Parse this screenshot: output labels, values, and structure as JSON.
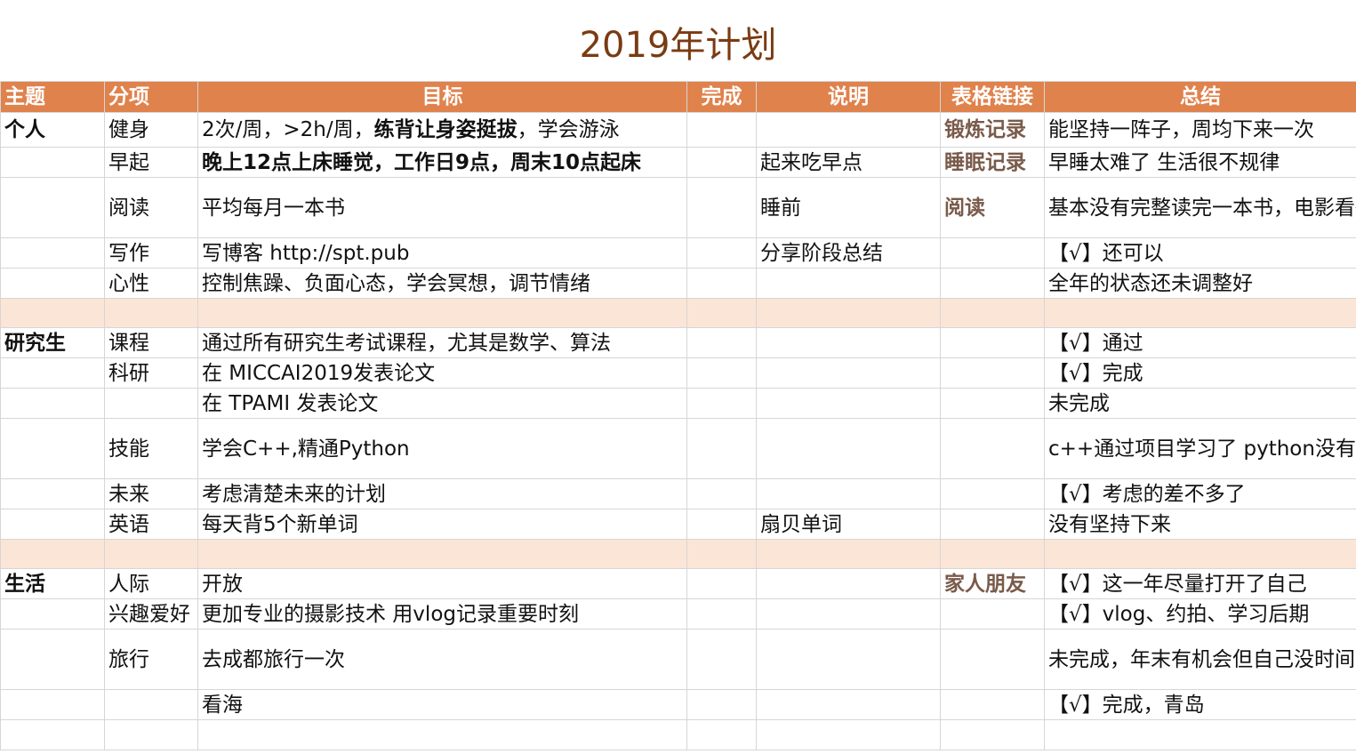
{
  "title": "2019年计划",
  "headers": [
    "主题",
    "分项",
    "目标",
    "完成",
    "说明",
    "表格链接",
    "总结"
  ],
  "rows": {
    "r1": {
      "theme": "个人",
      "sub": "健身",
      "goal_a": "2次/周，>2h/周，",
      "goal_bold": "练背让身姿挺拔",
      "goal_b": "，学会游泳",
      "done": "",
      "note": "",
      "link": "锻炼记录",
      "summary": "能坚持一阵子，周均下来一次"
    },
    "r2": {
      "theme": "",
      "sub": "早起",
      "goal_bold": "晚上12点上床睡觉，工作日9点，周末10点起床",
      "done": "",
      "note": "起来吃早点",
      "link": "睡眠记录",
      "summary": "早睡太难了 生活很不规律"
    },
    "r3": {
      "theme": "",
      "sub": "阅读",
      "goal": "平均每月一本书",
      "done": "",
      "note": "睡前",
      "link": "阅读",
      "summary": "基本没有完整读完一本书，电影看得倒是不少"
    },
    "r4": {
      "theme": "",
      "sub": "写作",
      "goal": "写博客 http://spt.pub",
      "done": "",
      "note": "分享阶段总结",
      "link": "",
      "summary": "【√】还可以"
    },
    "r5": {
      "theme": "",
      "sub": "心性",
      "goal": "控制焦躁、负面心态，学会冥想，调节情绪",
      "done": "",
      "note": "",
      "link": "",
      "summary": "全年的状态还未调整好"
    },
    "r6": {
      "theme": "研究生",
      "sub": "课程",
      "goal": "通过所有研究生考试课程，尤其是数学、算法",
      "done": "",
      "note": "",
      "link": "",
      "summary": "【√】通过"
    },
    "r7": {
      "theme": "",
      "sub": "科研",
      "goal": "在 MICCAI2019发表论文",
      "done": "",
      "note": "",
      "link": "",
      "summary": "【√】完成"
    },
    "r8": {
      "theme": "",
      "sub": "",
      "goal": "在 TPAMI 发表论文",
      "done": "",
      "note": "",
      "link": "",
      "summary": "未完成"
    },
    "r9": {
      "theme": "",
      "sub": "技能",
      "goal": "学会C++,精通Python",
      "done": "",
      "note": "",
      "link": "",
      "summary": "c++通过项目学习了 python没有精进"
    },
    "r10": {
      "theme": "",
      "sub": "未来",
      "goal": "考虑清楚未来的计划",
      "done": "",
      "note": "",
      "link": "",
      "summary": "【√】考虑的差不多了"
    },
    "r11": {
      "theme": "",
      "sub": "英语",
      "goal": "每天背5个新单词",
      "done": "",
      "note": "扇贝单词",
      "link": "",
      "summary": "没有坚持下来"
    },
    "r12": {
      "theme": "生活",
      "sub": "人际",
      "goal": "开放",
      "done": "",
      "note": "",
      "link": "家人朋友",
      "summary": "【√】这一年尽量打开了自己"
    },
    "r13": {
      "theme": "",
      "sub": "兴趣爱好",
      "goal": "更加专业的摄影技术 用vlog记录重要时刻",
      "done": "",
      "note": "",
      "link": "",
      "summary": "【√】vlog、约拍、学习后期"
    },
    "r14": {
      "theme": "",
      "sub": "旅行",
      "goal": "去成都旅行一次",
      "done": "",
      "note": "",
      "link": "",
      "summary": "未完成，年末有机会但自己没时间"
    },
    "r15": {
      "theme": "",
      "sub": "",
      "goal": "看海",
      "done": "",
      "note": "",
      "link": "",
      "summary": "【√】完成，青岛"
    }
  },
  "colors": {
    "header_bg": "#e0824c",
    "separator_bg": "#fbe5d6",
    "title_color": "#7a3b12",
    "link_color": "#7a5a4a"
  }
}
